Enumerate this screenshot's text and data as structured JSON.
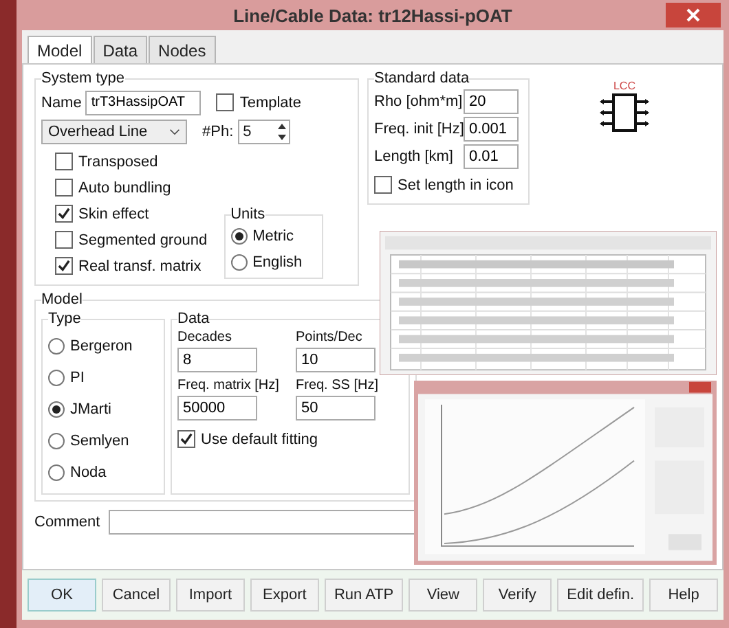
{
  "window": {
    "title": "Line/Cable Data: tr12Hassi-pOAT"
  },
  "tabs": [
    {
      "label": "Model",
      "selected": true
    },
    {
      "label": "Data",
      "selected": false
    },
    {
      "label": "Nodes",
      "selected": false
    }
  ],
  "system_type": {
    "title": "System type",
    "name_label": "Name",
    "name_value": "trT3HassipOAT",
    "template": {
      "label": "Template",
      "checked": false
    },
    "line_type": "Overhead Line",
    "phases_label": "#Ph:",
    "phases_value": "5",
    "options": [
      {
        "label": "Transposed",
        "checked": false
      },
      {
        "label": "Auto bundling",
        "checked": false
      },
      {
        "label": "Skin effect",
        "checked": true
      },
      {
        "label": "Segmented ground",
        "checked": false
      },
      {
        "label": "Real transf. matrix",
        "checked": true
      }
    ]
  },
  "units": {
    "title": "Units",
    "options": [
      {
        "label": "Metric",
        "selected": true
      },
      {
        "label": "English",
        "selected": false
      }
    ]
  },
  "standard_data": {
    "title": "Standard data",
    "rows": [
      {
        "label": "Rho [ohm*m]",
        "value": "20"
      },
      {
        "label": "Freq. init [Hz]",
        "value": "0.001"
      },
      {
        "label": "Length [km]",
        "value": "0.01"
      }
    ],
    "set_length": {
      "label": "Set length in icon",
      "checked": false
    }
  },
  "component_icon": {
    "label": "LCC"
  },
  "model": {
    "title": "Model",
    "type": {
      "title": "Type",
      "options": [
        {
          "label": "Bergeron",
          "selected": false
        },
        {
          "label": "PI",
          "selected": false
        },
        {
          "label": "JMarti",
          "selected": true
        },
        {
          "label": "Semlyen",
          "selected": false
        },
        {
          "label": "Noda",
          "selected": false
        }
      ]
    },
    "data": {
      "title": "Data",
      "fields": [
        {
          "label": "Decades",
          "value": "8"
        },
        {
          "label": "Points/Dec",
          "value": "10"
        },
        {
          "label": "Freq. matrix [Hz]",
          "value": "50000"
        },
        {
          "label": "Freq. SS [Hz]",
          "value": "50"
        }
      ],
      "use_default_fitting": {
        "label": "Use default fitting",
        "checked": true
      }
    }
  },
  "comment": {
    "label": "Comment"
  },
  "buttons": [
    "OK",
    "Cancel",
    "Import",
    "Export",
    "Run ATP",
    "View",
    "Verify",
    "Edit defin.",
    "Help"
  ]
}
